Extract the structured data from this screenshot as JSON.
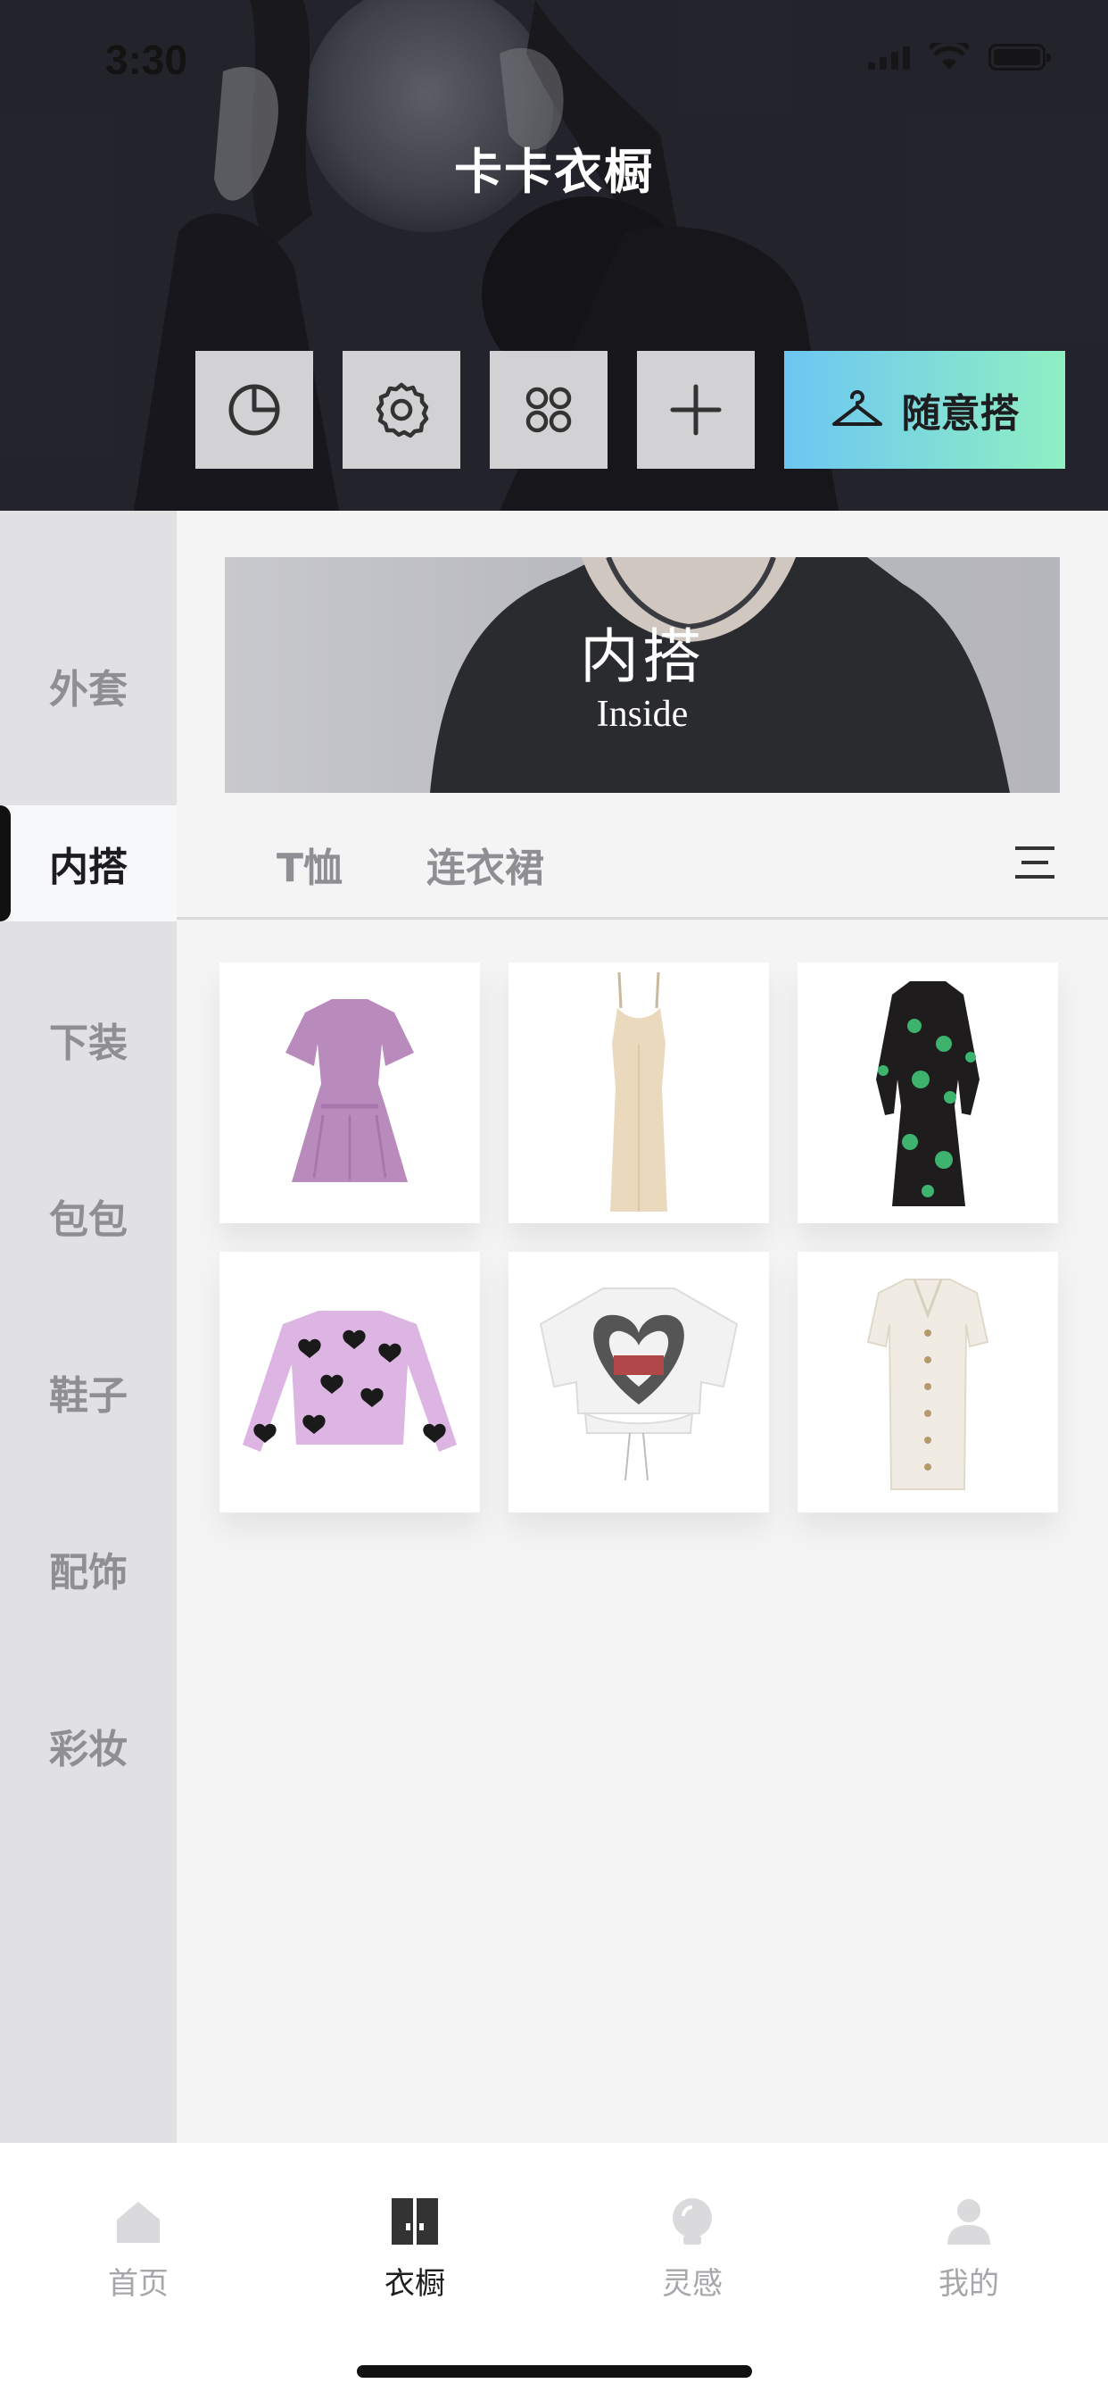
{
  "status_bar": {
    "time": "3:30"
  },
  "header": {
    "title": "卡卡衣橱",
    "tools": [
      {
        "name": "stats",
        "icon": "pie-chart-icon"
      },
      {
        "name": "settings",
        "icon": "gear-icon"
      },
      {
        "name": "layout",
        "icon": "grid-icon"
      },
      {
        "name": "add",
        "icon": "plus-icon"
      }
    ],
    "random_outfit_label": "随意搭",
    "random_outfit_icon": "hanger-icon",
    "accent_gradient": [
      "#6cc6f2",
      "#8fefc2"
    ]
  },
  "sidebar": {
    "items": [
      {
        "label": "外套",
        "active": false
      },
      {
        "label": "内搭",
        "active": true
      },
      {
        "label": "下装",
        "active": false
      },
      {
        "label": "包包",
        "active": false
      },
      {
        "label": "鞋子",
        "active": false
      },
      {
        "label": "配饰",
        "active": false
      },
      {
        "label": "彩妆",
        "active": false
      }
    ]
  },
  "banner": {
    "title": "内搭",
    "subtitle": "Inside"
  },
  "subcategories": {
    "tabs": [
      "T恤",
      "连衣裙"
    ],
    "menu_icon": "list-menu-icon"
  },
  "items": [
    {
      "name": "lilac-flutter-sleeve-mini-dress",
      "color": "#b98bbd"
    },
    {
      "name": "cream-slip-maxi-dress",
      "color": "#ead9bd"
    },
    {
      "name": "black-green-floral-wrap-dress",
      "color": "#1e1c1c"
    },
    {
      "name": "lilac-heart-print-long-sleeve-top",
      "color": "#dcb5e3"
    },
    {
      "name": "white-heart-graphic-crop-tee",
      "color": "#f2f2f2"
    },
    {
      "name": "ivory-button-front-knit-dress",
      "color": "#f1ece3"
    }
  ],
  "tabbar": {
    "tabs": [
      {
        "label": "首页",
        "icon": "home-icon",
        "active": false
      },
      {
        "label": "衣橱",
        "icon": "wardrobe-icon",
        "active": true
      },
      {
        "label": "灵感",
        "icon": "lightbulb-icon",
        "active": false
      },
      {
        "label": "我的",
        "icon": "person-icon",
        "active": false
      }
    ]
  }
}
